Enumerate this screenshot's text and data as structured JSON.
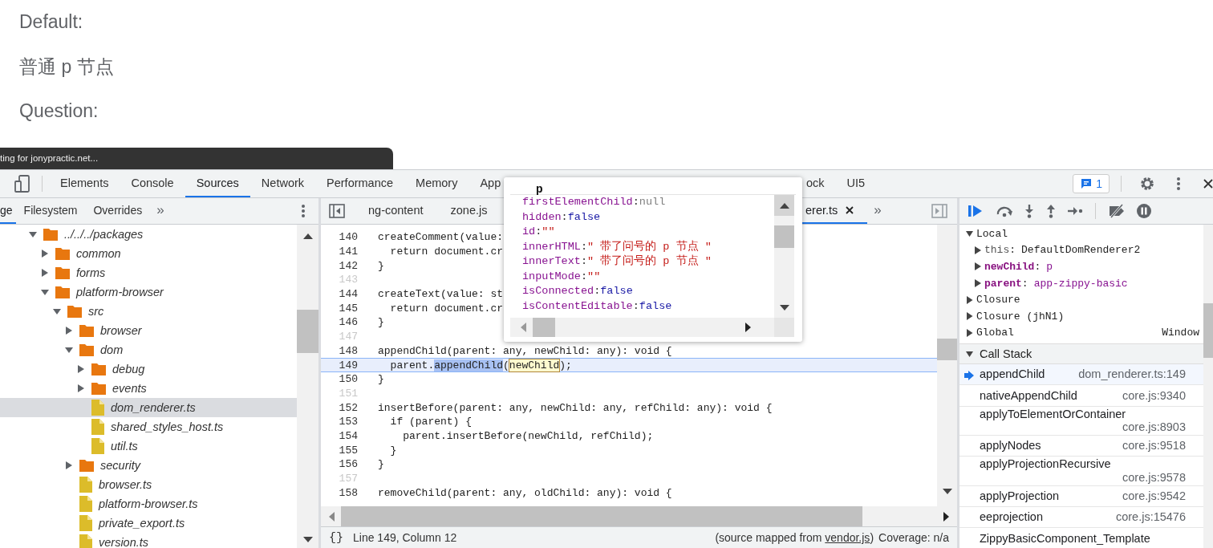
{
  "page": {
    "lines": [
      "Default:",
      "普通 p 节点",
      "Question:"
    ]
  },
  "status_tooltip": "ting for jonypractic.net...",
  "devtools": {
    "tabs": [
      {
        "label": "Elements",
        "selected": false
      },
      {
        "label": "Console",
        "selected": false
      },
      {
        "label": "Sources",
        "selected": true
      },
      {
        "label": "Network",
        "selected": false
      },
      {
        "label": "Performance",
        "selected": false
      },
      {
        "label": "Memory",
        "selected": false
      },
      {
        "label": "App",
        "selected": false
      }
    ],
    "tabs_right": [
      {
        "label": "ock",
        "selected": false
      },
      {
        "label": "UI5",
        "selected": false
      }
    ],
    "issues_count": "1"
  },
  "navigator": {
    "tabs": [
      {
        "label": "ge",
        "selected": true
      },
      {
        "label": "Filesystem",
        "selected": false
      },
      {
        "label": "Overrides",
        "selected": false
      }
    ],
    "more": "»",
    "tree": [
      {
        "label": "../../../packages",
        "kind": "folder",
        "expanded": true,
        "selected": false,
        "children": [
          {
            "label": "common",
            "kind": "folder",
            "expanded": false,
            "selected": false
          },
          {
            "label": "forms",
            "kind": "folder",
            "expanded": false,
            "selected": false
          },
          {
            "label": "platform-browser",
            "kind": "folder",
            "expanded": true,
            "selected": false,
            "children": [
              {
                "label": "src",
                "kind": "folder",
                "expanded": true,
                "selected": false,
                "children": [
                  {
                    "label": "browser",
                    "kind": "folder",
                    "expanded": false,
                    "selected": false
                  },
                  {
                    "label": "dom",
                    "kind": "folder",
                    "expanded": true,
                    "selected": false,
                    "children": [
                      {
                        "label": "debug",
                        "kind": "folder",
                        "expanded": false,
                        "selected": false
                      },
                      {
                        "label": "events",
                        "kind": "folder",
                        "expanded": false,
                        "selected": false
                      },
                      {
                        "label": "dom_renderer.ts",
                        "kind": "file",
                        "selected": true
                      },
                      {
                        "label": "shared_styles_host.ts",
                        "kind": "file",
                        "selected": false
                      },
                      {
                        "label": "util.ts",
                        "kind": "file",
                        "selected": false
                      }
                    ]
                  },
                  {
                    "label": "security",
                    "kind": "folder",
                    "expanded": false,
                    "selected": false
                  },
                  {
                    "label": "browser.ts",
                    "kind": "file",
                    "selected": false
                  },
                  {
                    "label": "platform-browser.ts",
                    "kind": "file",
                    "selected": false
                  },
                  {
                    "label": "private_export.ts",
                    "kind": "file",
                    "selected": false
                  },
                  {
                    "label": "version.ts",
                    "kind": "file",
                    "selected": false
                  }
                ]
              }
            ]
          }
        ]
      }
    ]
  },
  "editor": {
    "tabs": [
      {
        "label": "ng-content",
        "selected": false
      },
      {
        "label": "zone.js",
        "selected": false
      }
    ],
    "tabs_right": [
      {
        "label": "erer.ts",
        "selected": true
      }
    ],
    "more": "»",
    "lines": [
      {
        "number": "140",
        "text": "createComment(value:",
        "dim": false,
        "current": false
      },
      {
        "number": "141",
        "text": "  return document.cr",
        "dim": false,
        "current": false
      },
      {
        "number": "142",
        "text": "}",
        "dim": false,
        "current": false
      },
      {
        "number": "143",
        "dim": true,
        "current": false
      },
      {
        "number": "144",
        "text": "createText(value: st",
        "dim": false,
        "current": false
      },
      {
        "number": "145",
        "text": "  return document.cr",
        "dim": false,
        "current": false
      },
      {
        "number": "146",
        "text": "}",
        "dim": false,
        "current": false
      },
      {
        "number": "147",
        "dim": true,
        "current": false
      },
      {
        "number": "148",
        "text": "appendChild(parent: any, newChild: any): void {",
        "dim": false,
        "current": false
      },
      {
        "number": "149",
        "dim": false,
        "current": true,
        "segments": [
          {
            "text": "  parent.",
            "kind": "plain"
          },
          {
            "text": "appendChild",
            "kind": "selection"
          },
          {
            "text": "(",
            "kind": "plain"
          },
          {
            "text": "newChild",
            "kind": "hover"
          },
          {
            "text": ");",
            "kind": "plain"
          }
        ]
      },
      {
        "number": "150",
        "text": "}",
        "dim": false,
        "current": false
      },
      {
        "number": "151",
        "dim": true,
        "current": false
      },
      {
        "number": "152",
        "text": "insertBefore(parent: any, newChild: any, refChild: any): void {",
        "dim": false,
        "current": false
      },
      {
        "number": "153",
        "text": "  if (parent) {",
        "dim": false,
        "current": false
      },
      {
        "number": "154",
        "text": "    parent.insertBefore(newChild, refChild);",
        "dim": false,
        "current": false
      },
      {
        "number": "155",
        "text": "  }",
        "dim": false,
        "current": false
      },
      {
        "number": "156",
        "text": "}",
        "dim": false,
        "current": false
      },
      {
        "number": "157",
        "dim": true,
        "current": false
      },
      {
        "number": "158",
        "text": "removeChild(parent: any, oldChild: any): void {",
        "dim": false,
        "current": false
      }
    ],
    "status": {
      "format_button": "{}",
      "cursor": "Line 149, Column 12",
      "source_prefix": "(source mapped from ",
      "source_link": "vendor.js",
      "source_suffix": ")",
      "coverage": "Coverage: n/a"
    }
  },
  "popup": {
    "title": "p",
    "separator": ":",
    "properties": [
      {
        "name": "firstElementChild",
        "value": "null",
        "kind": "null"
      },
      {
        "name": "hidden",
        "value": "false",
        "kind": "boolean"
      },
      {
        "name": "id",
        "value": "\"\"",
        "kind": "string"
      },
      {
        "name": "innerHTML",
        "value": "\" 带了问号的 p 节点 \"",
        "kind": "string"
      },
      {
        "name": "innerText",
        "value": "\" 带了问号的 p 节点 \"",
        "kind": "string"
      },
      {
        "name": "inputMode",
        "value": "\"\"",
        "kind": "string"
      },
      {
        "name": "isConnected",
        "value": "false",
        "kind": "boolean"
      },
      {
        "name": "isContentEditable",
        "value": "false",
        "kind": "boolean"
      }
    ]
  },
  "debugger": {
    "separator": ":",
    "scope": [
      {
        "label": "Local",
        "expanded": true,
        "children": [
          {
            "name": "this",
            "value": "DefaultDomRenderer2",
            "kind": "receiver"
          },
          {
            "name": "newChild",
            "value": "p",
            "kind": "argument"
          },
          {
            "name": "parent",
            "value": "app-zippy-basic",
            "kind": "argument"
          }
        ]
      },
      {
        "label": "Closure",
        "expanded": false
      },
      {
        "label": "Closure (jhN1)",
        "expanded": false
      },
      {
        "label": "Global",
        "expanded": false,
        "value": "Window"
      }
    ],
    "call_stack": {
      "label": "Call Stack",
      "expanded": true,
      "frames": [
        {
          "name": "appendChild",
          "location": "dom_renderer.ts:149",
          "selected": true
        },
        {
          "name": "nativeAppendChild",
          "location": "core.js:9340",
          "selected": false
        },
        {
          "name": "applyToElementOrContainer",
          "location": "core.js:8903",
          "selected": false
        },
        {
          "name": "applyNodes",
          "location": "core.js:9518",
          "selected": false
        },
        {
          "name": "applyProjectionRecursive",
          "location": "core.js:9578",
          "selected": false
        },
        {
          "name": "applyProjection",
          "location": "core.js:9542",
          "selected": false
        },
        {
          "name": "eeprojection",
          "location": "core.js:15476",
          "selected": false
        },
        {
          "name": "ZippyBasicComponent_Template",
          "selected": false
        }
      ]
    }
  }
}
